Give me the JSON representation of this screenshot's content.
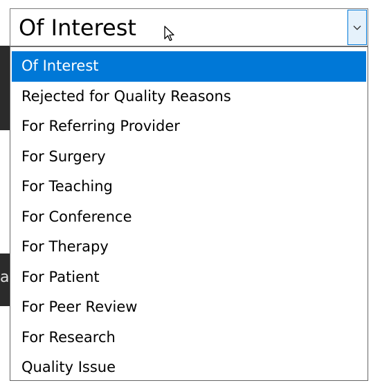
{
  "select": {
    "value": "Of Interest",
    "arrow_icon": "chevron-down-icon"
  },
  "options": [
    {
      "label": "Of Interest",
      "selected": true
    },
    {
      "label": "Rejected for Quality Reasons",
      "selected": false
    },
    {
      "label": "For Referring Provider",
      "selected": false
    },
    {
      "label": "For Surgery",
      "selected": false
    },
    {
      "label": "For Teaching",
      "selected": false
    },
    {
      "label": "For Conference",
      "selected": false
    },
    {
      "label": "For Therapy",
      "selected": false
    },
    {
      "label": "For Patient",
      "selected": false
    },
    {
      "label": "For Peer Review",
      "selected": false
    },
    {
      "label": "For Research",
      "selected": false
    },
    {
      "label": "Quality Issue",
      "selected": false
    }
  ],
  "colors": {
    "highlight": "#0078d7",
    "arrow_button_bg": "#e5f1fb"
  }
}
